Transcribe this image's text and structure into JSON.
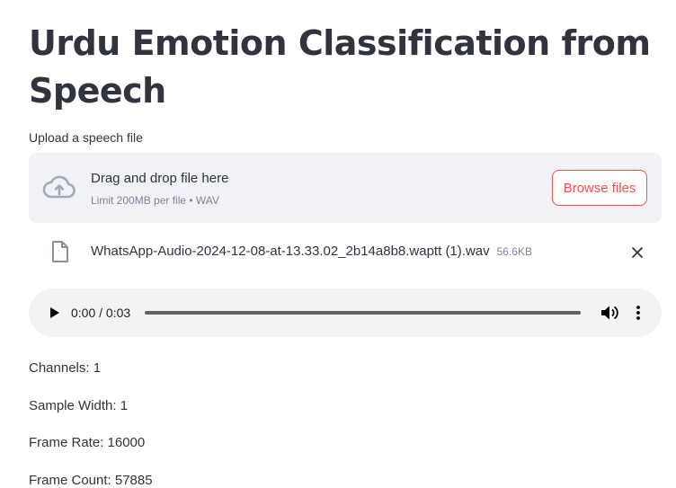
{
  "page": {
    "title": "Urdu Emotion Classification from Speech"
  },
  "uploader": {
    "label": "Upload a speech file",
    "drop_text": "Drag and drop file here",
    "limit_text": "Limit 200MB per file • WAV",
    "browse_label": "Browse files",
    "accent_color": "#ff4b4b"
  },
  "uploaded_file": {
    "name": "WhatsApp-Audio-2024-12-08-at-13.33.02_2b14a8b8.waptt (1).wav",
    "size": "56.6KB"
  },
  "audio": {
    "time_display": "0:00 / 0:03",
    "progress": 0
  },
  "info": [
    "Channels: 1",
    "Sample Width: 1",
    "Frame Rate: 16000",
    "Frame Count: 57885"
  ]
}
